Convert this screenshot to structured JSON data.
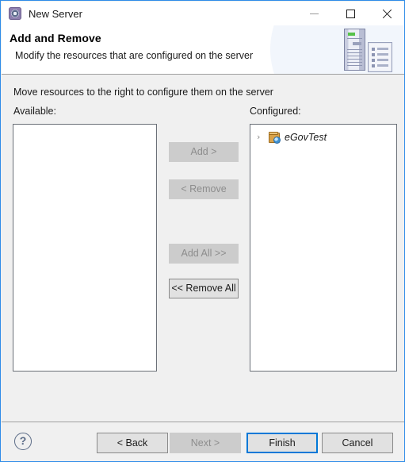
{
  "window": {
    "title": "New Server",
    "icon": "server-gear-icon",
    "controls": {
      "minimize": "minimize-icon",
      "maximize": "maximize-icon",
      "close": "close-icon"
    }
  },
  "header": {
    "title": "Add and Remove",
    "description": "Modify the resources that are configured on the server",
    "graphic": "server-tower-and-document-icon"
  },
  "body": {
    "instruction": "Move resources to the right to configure them on the server",
    "available": {
      "label": "Available:",
      "items": []
    },
    "configured": {
      "label": "Configured:",
      "items": [
        {
          "label": "eGovTest",
          "icon": "web-project-icon",
          "twisty": "›",
          "expanded": false,
          "italic": true
        }
      ]
    },
    "transfer_buttons": [
      {
        "key": "add",
        "label": "Add >",
        "enabled": false
      },
      {
        "key": "remove",
        "label": "< Remove",
        "enabled": false
      },
      {
        "key": "add_all",
        "label": "Add All >>",
        "enabled": false
      },
      {
        "key": "remove_all",
        "label": "<< Remove All",
        "enabled": true
      }
    ]
  },
  "footer": {
    "help": "?",
    "buttons": [
      {
        "key": "back",
        "label": "< Back",
        "enabled": true,
        "default": false
      },
      {
        "key": "next",
        "label": "Next >",
        "enabled": false,
        "default": false
      },
      {
        "key": "finish",
        "label": "Finish",
        "enabled": true,
        "default": true
      },
      {
        "key": "cancel",
        "label": "Cancel",
        "enabled": true,
        "default": false
      }
    ]
  },
  "colors": {
    "window_border": "#2f8ce8",
    "dialog_bg": "#f0f0f0",
    "white": "#ffffff",
    "default_button_outline": "#0078d7",
    "text": "#1b1b1b",
    "disabled_text": "#8d8d8d",
    "separator": "#a0a0a0"
  }
}
